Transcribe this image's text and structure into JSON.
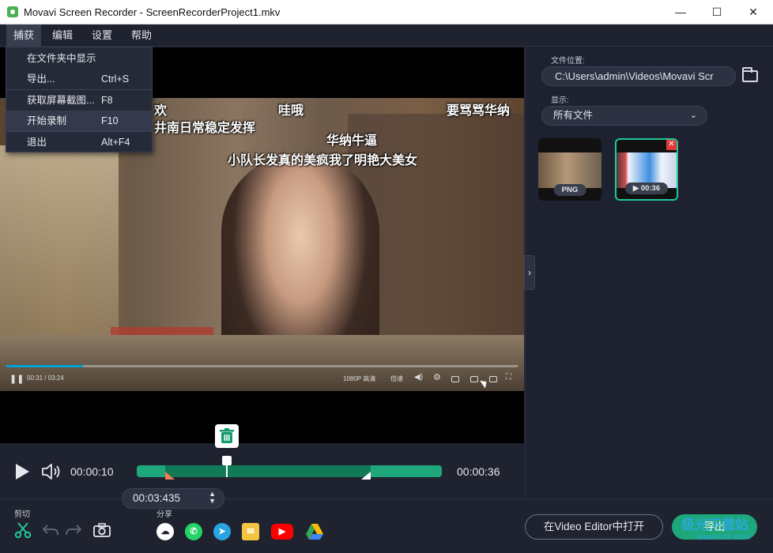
{
  "window": {
    "title": "Movavi Screen Recorder - ScreenRecorderProject1.mkv",
    "minimize": "—",
    "maximize": "☐",
    "close": "✕"
  },
  "menubar": {
    "items": [
      {
        "label": "捕获"
      },
      {
        "label": "编辑"
      },
      {
        "label": "设置"
      },
      {
        "label": "帮助"
      }
    ]
  },
  "capture_menu": {
    "items": [
      {
        "label": "在文件夹中显示",
        "shortcut": ""
      },
      {
        "label": "导出...",
        "shortcut": "Ctrl+S"
      },
      {
        "label": "获取屏幕截图...",
        "shortcut": "F8"
      },
      {
        "label": "开始录制",
        "shortcut": "F10"
      },
      {
        "label": "退出",
        "shortcut": "Alt+F4"
      }
    ]
  },
  "video": {
    "danmu": [
      {
        "text": "欢"
      },
      {
        "text": "哇哦"
      },
      {
        "text": "要骂骂华纳"
      },
      {
        "text": "井南日常稳定发挥"
      },
      {
        "text": "华纳牛逼"
      },
      {
        "text": "小队长发真的美疯我了明艳大美女"
      }
    ],
    "player_time": "00:31 / 03:24",
    "quality": "1080P 高清",
    "speed": "倍速",
    "progress_fraction": 0.15
  },
  "right_panel": {
    "file_location_label": "文件位置:",
    "file_path": "C:\\Users\\admin\\Videos\\Movavi Scr",
    "display_label": "显示:",
    "filter_value": "所有文件",
    "thumbnails": [
      {
        "badge": "PNG"
      },
      {
        "badge": "▶ 00:36",
        "close": "✕"
      }
    ],
    "collapse": "›"
  },
  "timeline": {
    "current_time": "00:00:10",
    "total_time": "00:00:36",
    "position_input": "00:03:435",
    "stepper_up": "▲",
    "stepper_down": "▼"
  },
  "bottom": {
    "cut_label": "剪切",
    "share_label": "分享",
    "open_editor": "在Video Editor中打开",
    "export": "导出"
  },
  "watermark": {
    "line1": "极光下载站",
    "line2": "www.xz7.com"
  },
  "colors": {
    "accent": "#1ea77a",
    "selected_border": "#21c79a",
    "background": "#1f2330"
  }
}
